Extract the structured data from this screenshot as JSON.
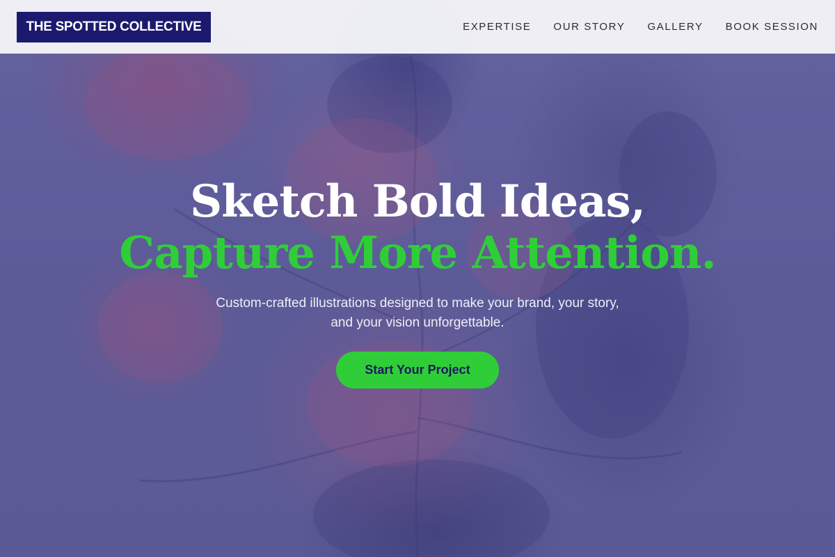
{
  "header": {
    "logo_text": "THE SPOTTED COLLECTIVE",
    "nav": [
      {
        "label": "EXPERTISE"
      },
      {
        "label": "OUR STORY"
      },
      {
        "label": "GALLERY"
      },
      {
        "label": "BOOK SESSION"
      }
    ]
  },
  "hero": {
    "headline_line1": "Sketch Bold Ideas,",
    "headline_line2": "Capture More Attention.",
    "subtitle_line1": "Custom-crafted illustrations designed to make your brand, your story,",
    "subtitle_line2": "and your vision unforgettable.",
    "cta_label": "Start Your Project",
    "background_image": "floral-engraving-illustration"
  },
  "colors": {
    "brand_navy": "#1c1a6e",
    "accent_green": "#2fce38",
    "hero_overlay": "#5e5e98",
    "header_bg": "#f4f4f8"
  }
}
